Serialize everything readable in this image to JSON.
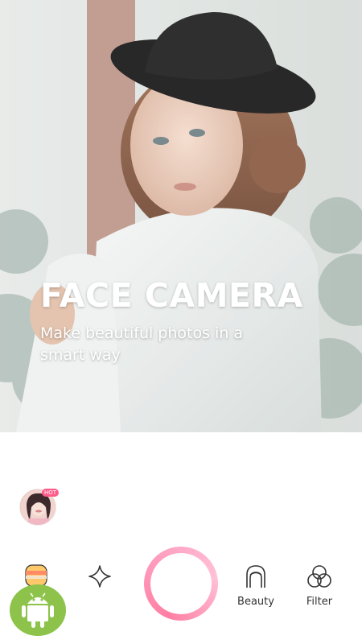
{
  "hero": {
    "title": "FACE CAMERA",
    "subtitle": "Make beautiful photos in a smart way"
  },
  "thumbnail": {
    "badge": "HOT"
  },
  "toolbar": {
    "sticker_icon": "sticker-icon",
    "effect_icon": "sparkle-icon",
    "beauty_label": "Beauty",
    "beauty_icon": "face-outline-icon",
    "filter_label": "Filter",
    "filter_icon": "three-circles-icon",
    "shutter_color": "#ff8fb1"
  },
  "overlay": {
    "badge_icon": "android-icon",
    "badge_color": "#8dc34a"
  }
}
